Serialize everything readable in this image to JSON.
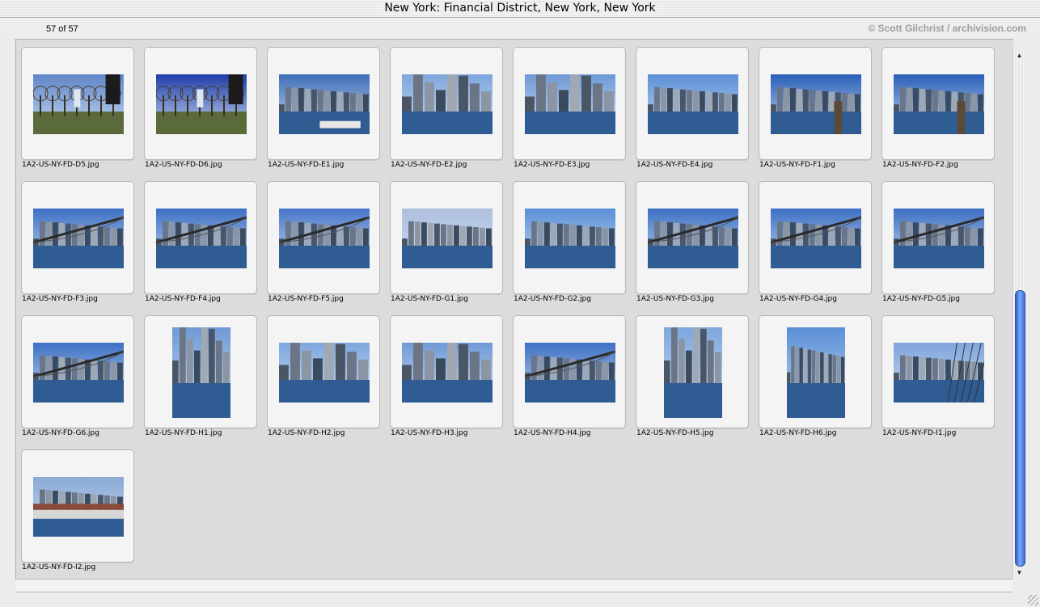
{
  "window": {
    "title": "New York: Financial District, New York, New York"
  },
  "info": {
    "count": "57 of 57",
    "credit": "© Scott Gilchrist / archivision.com"
  },
  "thumbnails": [
    {
      "file": "1A2-US-NY-FD-D5.jpg",
      "orient": "landscape",
      "scene": "park"
    },
    {
      "file": "1A2-US-NY-FD-D6.jpg",
      "orient": "landscape",
      "scene": "park-blue"
    },
    {
      "file": "1A2-US-NY-FD-E1.jpg",
      "orient": "landscape",
      "scene": "harbor"
    },
    {
      "file": "1A2-US-NY-FD-E2.jpg",
      "orient": "landscape",
      "scene": "towers"
    },
    {
      "file": "1A2-US-NY-FD-E3.jpg",
      "orient": "landscape",
      "scene": "towers-close"
    },
    {
      "file": "1A2-US-NY-FD-E4.jpg",
      "orient": "landscape",
      "scene": "skyline"
    },
    {
      "file": "1A2-US-NY-FD-F1.jpg",
      "orient": "landscape",
      "scene": "river-pilings"
    },
    {
      "file": "1A2-US-NY-FD-F2.jpg",
      "orient": "landscape",
      "scene": "river-pilings"
    },
    {
      "file": "1A2-US-NY-FD-F3.jpg",
      "orient": "landscape",
      "scene": "bridge"
    },
    {
      "file": "1A2-US-NY-FD-F4.jpg",
      "orient": "landscape",
      "scene": "bridge"
    },
    {
      "file": "1A2-US-NY-FD-F5.jpg",
      "orient": "landscape",
      "scene": "bridge-big"
    },
    {
      "file": "1A2-US-NY-FD-G1.jpg",
      "orient": "landscape",
      "scene": "skyline-pale"
    },
    {
      "file": "1A2-US-NY-FD-G2.jpg",
      "orient": "landscape",
      "scene": "skyline"
    },
    {
      "file": "1A2-US-NY-FD-G3.jpg",
      "orient": "landscape",
      "scene": "bridge"
    },
    {
      "file": "1A2-US-NY-FD-G4.jpg",
      "orient": "landscape",
      "scene": "bridge"
    },
    {
      "file": "1A2-US-NY-FD-G5.jpg",
      "orient": "landscape",
      "scene": "bridge"
    },
    {
      "file": "1A2-US-NY-FD-G6.jpg",
      "orient": "landscape",
      "scene": "bridge"
    },
    {
      "file": "1A2-US-NY-FD-H1.jpg",
      "orient": "portrait",
      "scene": "towers-close"
    },
    {
      "file": "1A2-US-NY-FD-H2.jpg",
      "orient": "landscape",
      "scene": "towers"
    },
    {
      "file": "1A2-US-NY-FD-H3.jpg",
      "orient": "landscape",
      "scene": "towers-close"
    },
    {
      "file": "1A2-US-NY-FD-H4.jpg",
      "orient": "landscape",
      "scene": "bridge"
    },
    {
      "file": "1A2-US-NY-FD-H5.jpg",
      "orient": "portrait",
      "scene": "towers"
    },
    {
      "file": "1A2-US-NY-FD-H6.jpg",
      "orient": "portrait",
      "scene": "skyline"
    },
    {
      "file": "1A2-US-NY-FD-I1.jpg",
      "orient": "landscape",
      "scene": "harbor-masts"
    },
    {
      "file": "1A2-US-NY-FD-I2.jpg",
      "orient": "landscape",
      "scene": "pier"
    }
  ],
  "scrollbar": {
    "up_icon": "arrow-up-icon",
    "down_icon": "arrow-down-icon",
    "accent": "#3a6fe0"
  }
}
